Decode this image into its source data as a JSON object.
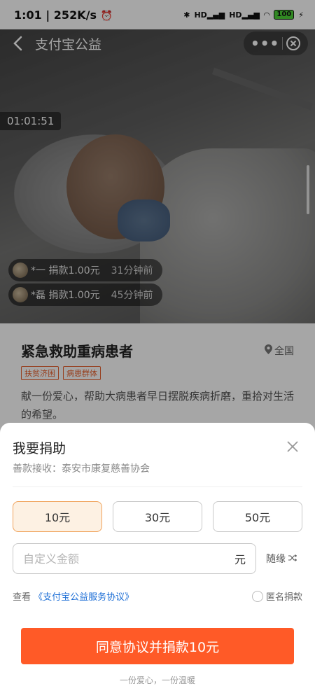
{
  "status": {
    "time": "1:01",
    "speed": "252K/s",
    "network1": "HD",
    "network2": "HD",
    "battery": "100"
  },
  "titlebar": {
    "title": "支付宝公益"
  },
  "hero": {
    "timer": "01:01:51",
    "donors": [
      {
        "name": "*一 捐款1.00元",
        "ago": "31分钟前"
      },
      {
        "name": "*磊 捐款1.00元",
        "ago": "45分钟前"
      }
    ]
  },
  "project": {
    "title": "紧急救助重病患者",
    "location": "全国",
    "tags": [
      "扶贫济困",
      "病患群体"
    ],
    "description": "献一份爱心，帮助大病患者早日摆脱疾病折磨，重拾对生活的希望。"
  },
  "sheet": {
    "title": "我要捐助",
    "receiver": "善款接收：泰安市康复慈善协会",
    "amounts": [
      "10元",
      "30元",
      "50元"
    ],
    "selected_index": 0,
    "custom_placeholder": "自定义金额",
    "unit": "元",
    "random_label": "随缘",
    "agree_prefix": "查看",
    "agree_link": "《支付宝公益服务协议》",
    "anonymous_label": "匿名捐款",
    "donate_label": "同意协议并捐款10元",
    "slogan": "一份爱心，一份温暖"
  },
  "colors": {
    "accent": "#ff5a27",
    "tag": "#e9612e",
    "link": "#1e6fd6",
    "selected_bg": "#fdf1e3"
  }
}
